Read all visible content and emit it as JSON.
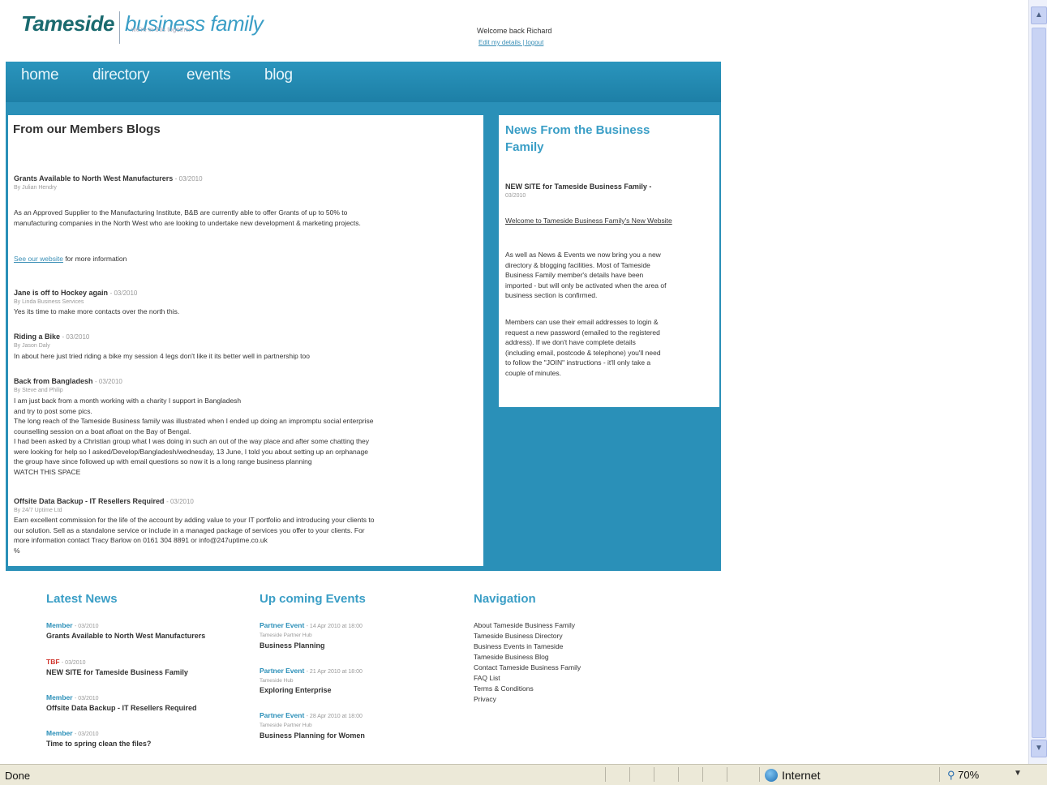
{
  "header": {
    "logo_part1": "Tameside",
    "logo_part2": "business family",
    "tagline": "we're in this together",
    "welcome": "Welcome back Richard",
    "account_link": "Edit my details | logout"
  },
  "nav": [
    "home",
    "directory",
    "events",
    "blog"
  ],
  "blogs": {
    "heading": "From our Members Blogs",
    "posts": [
      {
        "title": "Grants Available to North West Manufacturers",
        "date": "- 03/2010",
        "by": "By Julian Hendry",
        "body": [
          "As an Approved Supplier to the Manufacturing Institute, B&B are currently able to offer Grants of up to 50% to",
          "manufacturing companies in the North West who are looking to undertake new development & marketing projects."
        ],
        "link": "See our website",
        "link_suffix": " for more information"
      },
      {
        "title": "Jane is off to Hockey again",
        "date": "- 03/2010",
        "by": "By Linda Business Services",
        "body": [
          "Yes its time to make more contacts over the north this."
        ]
      },
      {
        "title": "Riding a Bike",
        "date": "- 03/2010",
        "by": "By Jason Daly",
        "body": [
          "In about here just tried riding a bike my session 4 legs don't like it its better well in partnership too"
        ]
      },
      {
        "title": "Back from Bangladesh",
        "date": "- 03/2010",
        "by": "By Steve and Philip",
        "body": [
          "I am just back from a month working with a charity I support in Bangladesh",
          "and try to post some pics.",
          "The long reach of the Tameside Business family was illustrated when I ended up doing an impromptu social enterprise",
          "counselling session on a boat afloat on the Bay of Bengal.",
          "I had been asked by a Christian group what I was doing in such an out of the way place and after some chatting they",
          "were looking for help so I asked/Develop/Bangladesh/wednesday, 13 June, I told you about setting up an orphanage",
          "the group have since followed up with email questions so now it is a long range business planning",
          "WATCH THIS SPACE"
        ]
      },
      {
        "title": "Offsite Data Backup - IT Resellers Required",
        "date": "- 03/2010",
        "by": "By 24/7 Uptime Ltd",
        "body": [
          "Earn excellent commission for the life of the account by adding value to your IT portfolio and introducing your clients to",
          "our solution. Sell as a standalone service or include in a managed package of services you offer to your clients. For",
          "more information contact Tracy Barlow on 0161 304 8891 or info@247uptime.co.uk",
          "%"
        ]
      }
    ]
  },
  "news": {
    "heading": "News From the Business Family",
    "item_title": "NEW SITE for Tameside Business Family -",
    "item_date": "03/2010",
    "item_link": "Welcome to Tameside Business Family's New Website",
    "para1": [
      "As well as News & Events we now bring you a new",
      "directory & blogging facilities. Most of Tameside",
      "Business Family member's details have been",
      "imported - but will only be activated when the area of",
      "business section is confirmed."
    ],
    "para2": [
      "Members can use their email addresses to login &",
      "request a new password (emailed to the registered",
      "address). If we don't have complete details",
      "(including email, postcode & telephone) you'll need",
      "to follow the \"JOIN\" instructions - it'll only take a",
      "couple of minutes."
    ]
  },
  "footer": {
    "latest_heading": "Latest News",
    "latest": [
      {
        "cat": "Member",
        "date": "- 03/2010",
        "title": "Grants Available to North West Manufacturers",
        "color": "#2a8fb8"
      },
      {
        "cat": "TBF",
        "date": "- 03/2010",
        "title": "NEW SITE for Tameside Business Family",
        "color": "#d0342c"
      },
      {
        "cat": "Member",
        "date": "- 03/2010",
        "title": "Offsite Data Backup - IT Resellers Required",
        "color": "#2a8fb8"
      },
      {
        "cat": "Member",
        "date": "- 03/2010",
        "title": "Time to spring clean the files?",
        "color": "#2a8fb8"
      }
    ],
    "events_heading": "Up coming Events",
    "events": [
      {
        "cat": "Partner Event",
        "date": "- 14 Apr 2010 at 18:00",
        "sub": "Tameside Partner Hub",
        "title": "Business Planning"
      },
      {
        "cat": "Partner Event",
        "date": "- 21 Apr 2010 at 18:00",
        "sub": "Tameside Hub",
        "title": "Exploring Enterprise"
      },
      {
        "cat": "Partner Event",
        "date": "- 28 Apr 2010 at 18:00",
        "sub": "Tameside Partner Hub",
        "title": "Business Planning for Women"
      }
    ],
    "nav_heading": "Navigation",
    "nav_links": [
      "About Tameside Business Family",
      "Tameside Business Directory",
      "Business Events in Tameside",
      "Tameside Business Blog",
      "Contact Tameside Business Family",
      "FAQ List",
      "Terms & Conditions",
      "Privacy"
    ]
  },
  "statusbar": {
    "status": "Done",
    "zone": "Internet",
    "zoom": "70%",
    "dropdown": "▼"
  },
  "scroll": {
    "up": "▲",
    "down": "▼"
  },
  "icons": {
    "globe": "globe-icon",
    "zoom": "magnifier-icon"
  },
  "colors": {
    "brand_blue": "#2a90b8",
    "heading_blue": "#3a9ec6",
    "logo_dark": "#1a6a6f",
    "tbf_red": "#d0342c"
  }
}
